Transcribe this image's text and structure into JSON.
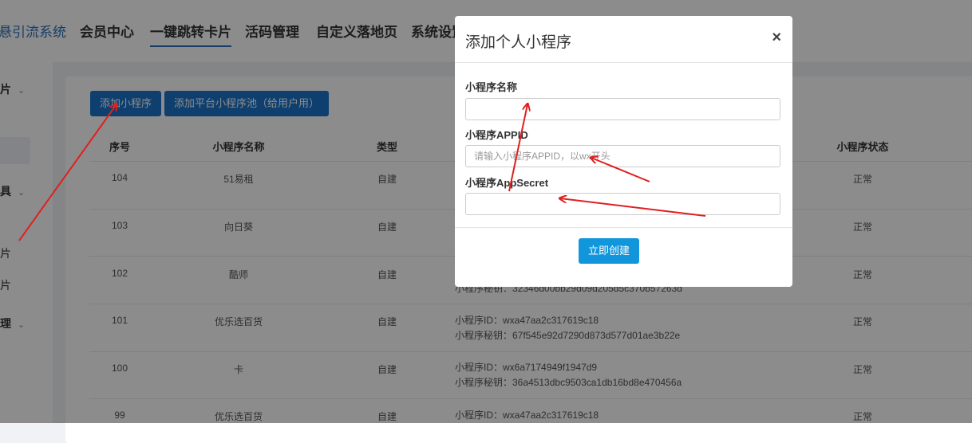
{
  "brand": "悬引流系统",
  "nav": [
    "会员中心",
    "一键跳转卡片",
    "活码管理",
    "自定义落地页",
    "系统设置"
  ],
  "sidebar": [
    {
      "label": "片",
      "chevron": "⌄"
    },
    {
      "label": "具",
      "chevron": "⌄"
    },
    {
      "label": "片"
    },
    {
      "label": "片"
    },
    {
      "label": "理",
      "chevron": "⌄"
    }
  ],
  "toolbar": {
    "add_label": "添加小程序",
    "add_pool_label": "添加平台小程序池（给用户用）"
  },
  "table": {
    "headers": [
      "序号",
      "小程序名称",
      "类型",
      "小程序状态"
    ],
    "rows": [
      {
        "id": "104",
        "name": "51易租",
        "type": "自建",
        "status": "正常",
        "appid": "",
        "secret": ""
      },
      {
        "id": "103",
        "name": "向日葵",
        "type": "自建",
        "status": "正常",
        "appid": "",
        "secret": ""
      },
      {
        "id": "102",
        "name": "酷师",
        "type": "自建",
        "status": "正常",
        "appid": "",
        "secret": "小程序秘钥：32346d00bb29d09d205d5c370b57263d"
      },
      {
        "id": "101",
        "name": "优乐选百货",
        "type": "自建",
        "status": "正常",
        "appid": "小程序ID：wxa47aa2c317619c18",
        "secret": "小程序秘钥：67f545e92d7290d873d577d01ae3b22e"
      },
      {
        "id": "100",
        "name": "卡",
        "type": "自建",
        "status": "正常",
        "appid": "小程序ID：wx6a7174949f1947d9",
        "secret": "小程序秘钥：36a4513dbc9503ca1db16bd8e470456a"
      },
      {
        "id": "99",
        "name": "优乐选百货",
        "type": "自建",
        "status": "正常",
        "appid": "小程序ID：wxa47aa2c317619c18",
        "secret": ""
      }
    ]
  },
  "modal": {
    "title": "添加个人小程序",
    "close": "×",
    "name_label": "小程序名称",
    "name_value": "",
    "appid_label": "小程序APPID",
    "appid_placeholder": "请输入小程序APPID，以wx开头",
    "secret_label": "小程序AppSecret",
    "secret_value": "",
    "submit_label": "立即创建"
  },
  "colors": {
    "accent": "#1a73c9",
    "submit": "#1296db",
    "annotation": "#e02020"
  }
}
